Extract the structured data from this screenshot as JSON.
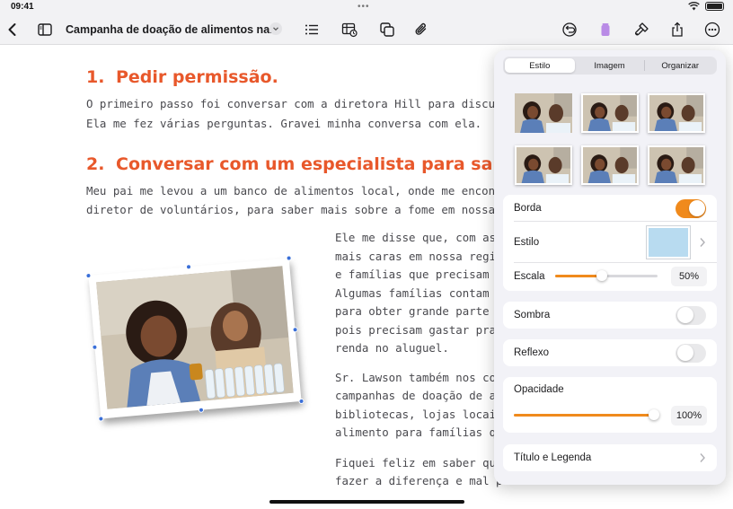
{
  "status": {
    "time": "09:41",
    "dots": "•••"
  },
  "toolbar": {
    "doc_title": "Campanha de doação de alimentos na...",
    "icons": [
      "back-chevron-icon",
      "sidebar-icon",
      "list-icon",
      "table-icon",
      "shapes-icon",
      "attachment-icon",
      "undo-icon",
      "media-icon",
      "format-brush-icon",
      "share-icon",
      "more-icon"
    ]
  },
  "document": {
    "heading1": {
      "number": "1.",
      "text": "Pedir permissão."
    },
    "para1": [
      "O primeiro passo foi conversar com a diretora Hill para discutir o pr",
      "Ela me fez várias perguntas. Gravei minha conversa com ela."
    ],
    "heading2": {
      "number": "2.",
      "text": "Conversar com um especialista para sabe"
    },
    "para2": [
      "Meu pai me levou a um banco de alimentos local, onde me encontrei c",
      "diretor de voluntários, para saber mais sobre a fome em nossa comu"
    ],
    "column1": [
      "Ele me disse que, com as m",
      "mais caras em nossa região",
      "e famílias que precisam de c",
      "Algumas famílias contam c",
      "para obter grande parte do",
      "pois precisam gastar prati",
      "renda no aluguel."
    ],
    "column2": [
      "Sr. Lawson também nos co",
      "campanhas de doação de a",
      "bibliotecas, lojas locais e igre",
      "alimento para famílias que"
    ],
    "column3": [
      "Fiquei feliz em saber que ess",
      "fazer a diferença e mal pod"
    ]
  },
  "format_panel": {
    "tabs": [
      {
        "label": "Estilo",
        "active": true
      },
      {
        "label": "Imagem",
        "active": false
      },
      {
        "label": "Organizar",
        "active": false
      }
    ],
    "border": {
      "label": "Borda",
      "on": true
    },
    "style": {
      "label": "Estilo"
    },
    "scale": {
      "label": "Escala",
      "value": "50%",
      "level": 0.5
    },
    "shadow": {
      "label": "Sombra",
      "on": false
    },
    "reflection": {
      "label": "Reflexo",
      "on": false
    },
    "opacity": {
      "label": "Opacidade",
      "value": "100%",
      "level": 1.0
    },
    "title_caption": {
      "label": "Título e Legenda"
    }
  },
  "colors": {
    "accent": "#f08a1c",
    "heading": "#e8582b",
    "handle": "#3a6fd8"
  }
}
